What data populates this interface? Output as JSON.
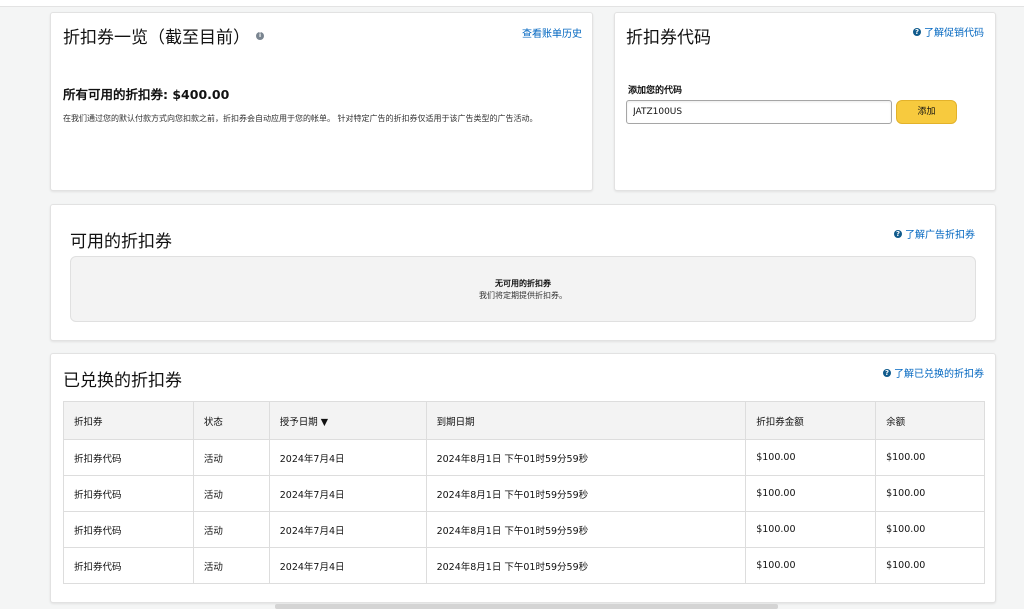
{
  "summary": {
    "title": "折扣券一览（截至目前）",
    "history_link": "查看账单历史",
    "total_label": "所有可用的折扣券: $400.00",
    "description": "在我们通过您的默认付款方式向您扣款之前，折扣券会自动应用于您的帐单。 针对特定广告的折扣券仅适用于该广告类型的广告活动。"
  },
  "code_card": {
    "title": "折扣券代码",
    "learn_link": "了解促销代码",
    "add_label": "添加您的代码",
    "code_value": "JATZ100US",
    "add_button": "添加"
  },
  "available": {
    "title": "可用的折扣券",
    "learn_link": "了解广告折扣券",
    "empty_title": "无可用的折扣券",
    "empty_sub": "我们将定期提供折扣券。"
  },
  "redeemed": {
    "title": "已兑换的折扣券",
    "learn_link": "了解已兑换的折扣券",
    "columns": [
      "折扣券",
      "状态",
      "授予日期 ▼",
      "到期日期",
      "折扣券金额",
      "余额"
    ],
    "rows": [
      [
        "折扣券代码",
        "活动",
        "2024年7月4日",
        "2024年8月1日 下午01时59分59秒",
        "$100.00",
        "$100.00"
      ],
      [
        "折扣券代码",
        "活动",
        "2024年7月4日",
        "2024年8月1日 下午01时59分59秒",
        "$100.00",
        "$100.00"
      ],
      [
        "折扣券代码",
        "活动",
        "2024年7月4日",
        "2024年8月1日 下午01时59分59秒",
        "$100.00",
        "$100.00"
      ],
      [
        "折扣券代码",
        "活动",
        "2024年7月4日",
        "2024年8月1日 下午01时59分59秒",
        "$100.00",
        "$100.00"
      ]
    ]
  },
  "colors": {
    "link": "#0066c0",
    "button": "#f7ca3e",
    "help_icon": "#0f5a8c"
  },
  "icons": {
    "info": "info-icon",
    "help": "help-circle-icon"
  }
}
